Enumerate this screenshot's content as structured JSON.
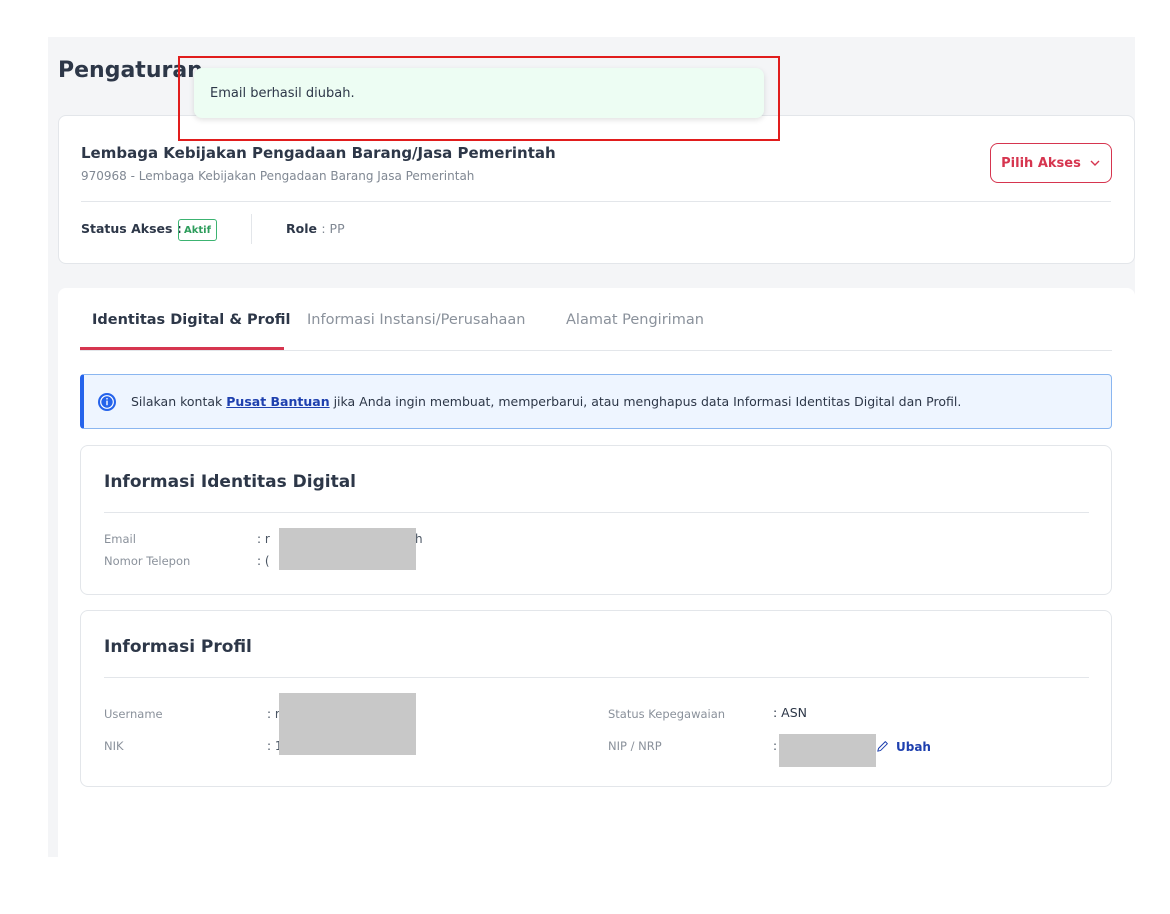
{
  "page": {
    "title": "Pengaturan"
  },
  "toast": {
    "message": "Email berhasil diubah."
  },
  "access": {
    "org_name": "Lembaga Kebijakan Pengadaan Barang/Jasa Pemerintah",
    "org_sub": "970968 - Lembaga Kebijakan Pengadaan Barang Jasa Pemerintah",
    "pilih_akses_label": "Pilih Akses",
    "status_label": "Status Akses :",
    "status_value": "Aktif",
    "role_label": "Role",
    "role_value": ": PP"
  },
  "tabs": [
    {
      "label": "Identitas Digital & Profil",
      "active": true
    },
    {
      "label": "Informasi Instansi/Perusahaan",
      "active": false
    },
    {
      "label": "Alamat Pengiriman",
      "active": false
    }
  ],
  "banner": {
    "text_before": "Silakan kontak ",
    "link_text": "Pusat Bantuan",
    "text_after": " jika Anda ingin membuat, memperbarui, atau menghapus data Informasi Identitas Digital dan Profil."
  },
  "digital_identity": {
    "title": "Informasi Identitas Digital",
    "email_label": "Email",
    "email_colon": ": r",
    "email_tail": "h",
    "phone_label": "Nomor Telepon",
    "phone_colon": ": ("
  },
  "profile": {
    "title": "Informasi Profil",
    "username_label": "Username",
    "username_colon": ": r",
    "nik_label": "NIK",
    "nik_colon": ": 1",
    "employment_label": "Status Kepegawaian",
    "employment_value": ": ASN",
    "nip_label": "NIP / NRP",
    "nip_colon": ":",
    "ubah_label": "Ubah"
  },
  "colors": {
    "accent_red": "#d6354f",
    "link_blue": "#1e40af",
    "success_green": "#2e9d5c",
    "toast_bg": "#edfdf3",
    "banner_bg": "#eef5ff"
  },
  "icons": {
    "pilih_akses": "chevron-down-icon",
    "banner": "info-icon",
    "ubah": "pencil-icon"
  }
}
